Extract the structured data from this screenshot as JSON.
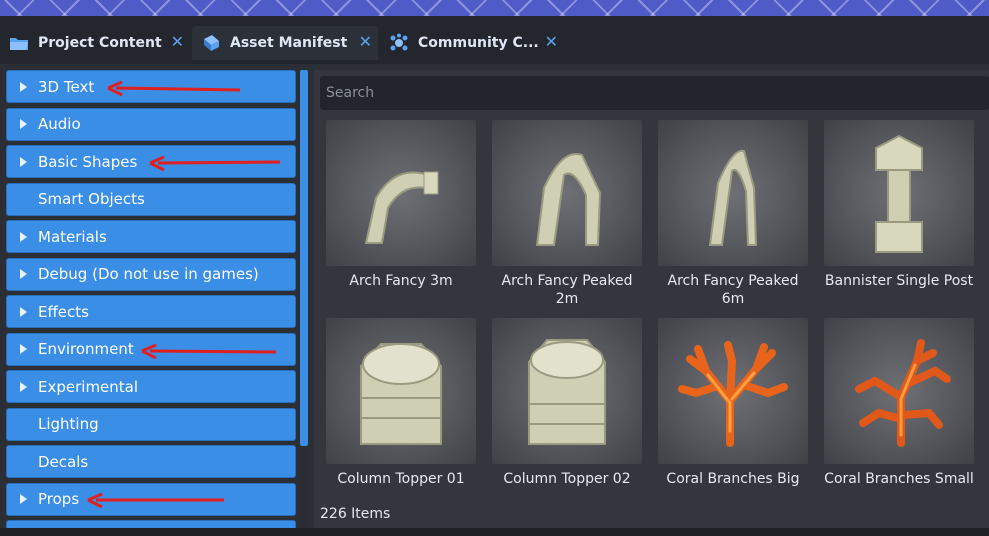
{
  "tabs": [
    {
      "label": "Project Content",
      "icon": "folder-icon",
      "close": "✕"
    },
    {
      "label": "Asset Manifest",
      "icon": "book-icon",
      "close": "✕"
    },
    {
      "label": "Community C...",
      "icon": "community-icon",
      "close": "✕"
    }
  ],
  "sidebar": {
    "categories": [
      {
        "label": "3D Text",
        "expandable": true
      },
      {
        "label": "Audio",
        "expandable": true
      },
      {
        "label": "Basic Shapes",
        "expandable": true
      },
      {
        "label": "Smart Objects",
        "expandable": false
      },
      {
        "label": "Materials",
        "expandable": true
      },
      {
        "label": "Debug (Do not use in games)",
        "expandable": true
      },
      {
        "label": "Effects",
        "expandable": true
      },
      {
        "label": "Environment",
        "expandable": true
      },
      {
        "label": "Experimental",
        "expandable": true
      },
      {
        "label": "Lighting",
        "expandable": false
      },
      {
        "label": "Decals",
        "expandable": false
      },
      {
        "label": "Props",
        "expandable": true
      }
    ]
  },
  "search": {
    "placeholder": "Search"
  },
  "assets": [
    {
      "label": "Arch Fancy 3m",
      "icon": "arch-icon"
    },
    {
      "label": "Arch Fancy Peaked 2m",
      "icon": "arch-peaked-icon"
    },
    {
      "label": "Arch Fancy Peaked 6m",
      "icon": "arch-peaked-thin-icon"
    },
    {
      "label": "Bannister Single Post",
      "icon": "post-icon"
    },
    {
      "label": "Column Topper 01",
      "icon": "column-topper-icon"
    },
    {
      "label": "Column Topper 02",
      "icon": "column-topper-icon"
    },
    {
      "label": "Coral Branches Big",
      "icon": "coral-icon"
    },
    {
      "label": "Coral Branches Small",
      "icon": "coral-icon"
    }
  ],
  "status": {
    "items_count": "226 Items"
  },
  "colors": {
    "accent": "#3a8ee6",
    "annotation": "#e02020"
  }
}
